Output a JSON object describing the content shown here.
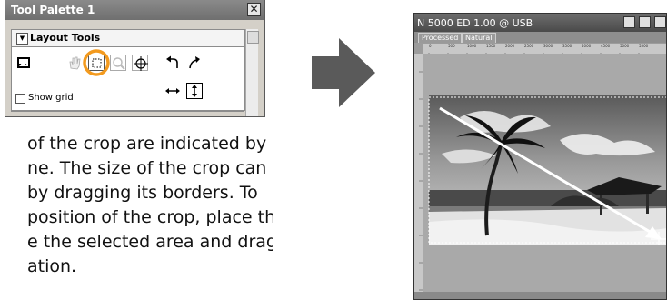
{
  "tool_palette": {
    "title": "Tool Palette 1",
    "close_glyph": "✕",
    "section": {
      "label": "Layout Tools",
      "expanded_glyph": "▼",
      "tools": [
        {
          "icon": "crop-image-icon",
          "selected": false
        },
        {
          "icon": "hand-icon",
          "selected": false
        },
        {
          "icon": "marquee-icon",
          "selected": true,
          "highlight_color": "#f39a1e"
        },
        {
          "icon": "zoom-icon",
          "selected": false
        },
        {
          "icon": "crosshair-icon",
          "selected": false
        },
        {
          "icon": "rotate-left-icon",
          "selected": false
        },
        {
          "icon": "rotate-right-icon",
          "selected": false
        },
        {
          "icon": "flip-horizontal-icon",
          "selected": false
        },
        {
          "icon": "flip-vertical-icon",
          "selected": false
        }
      ],
      "show_grid": {
        "label": "Show grid",
        "checked": false
      }
    }
  },
  "body_text": {
    "lines": [
      "of the crop are indicated by",
      "ne.  The size of the crop can",
      "by dragging its borders.  To",
      "position of the crop, place the",
      "e the selected area and drag it",
      "ation."
    ]
  },
  "arrow": {
    "color": "#5a5a5a",
    "direction": "right"
  },
  "scan_window": {
    "title": "N 5000 ED  1.00 @ USB",
    "tabs": [
      "Processed",
      "Natural"
    ],
    "ruler_labels": [
      "0",
      "500",
      "1000",
      "1500",
      "2000",
      "2500",
      "3000",
      "3500",
      "4000",
      "4500",
      "5000",
      "5500"
    ],
    "crop_drag_arrow_color": "#ffffff"
  }
}
